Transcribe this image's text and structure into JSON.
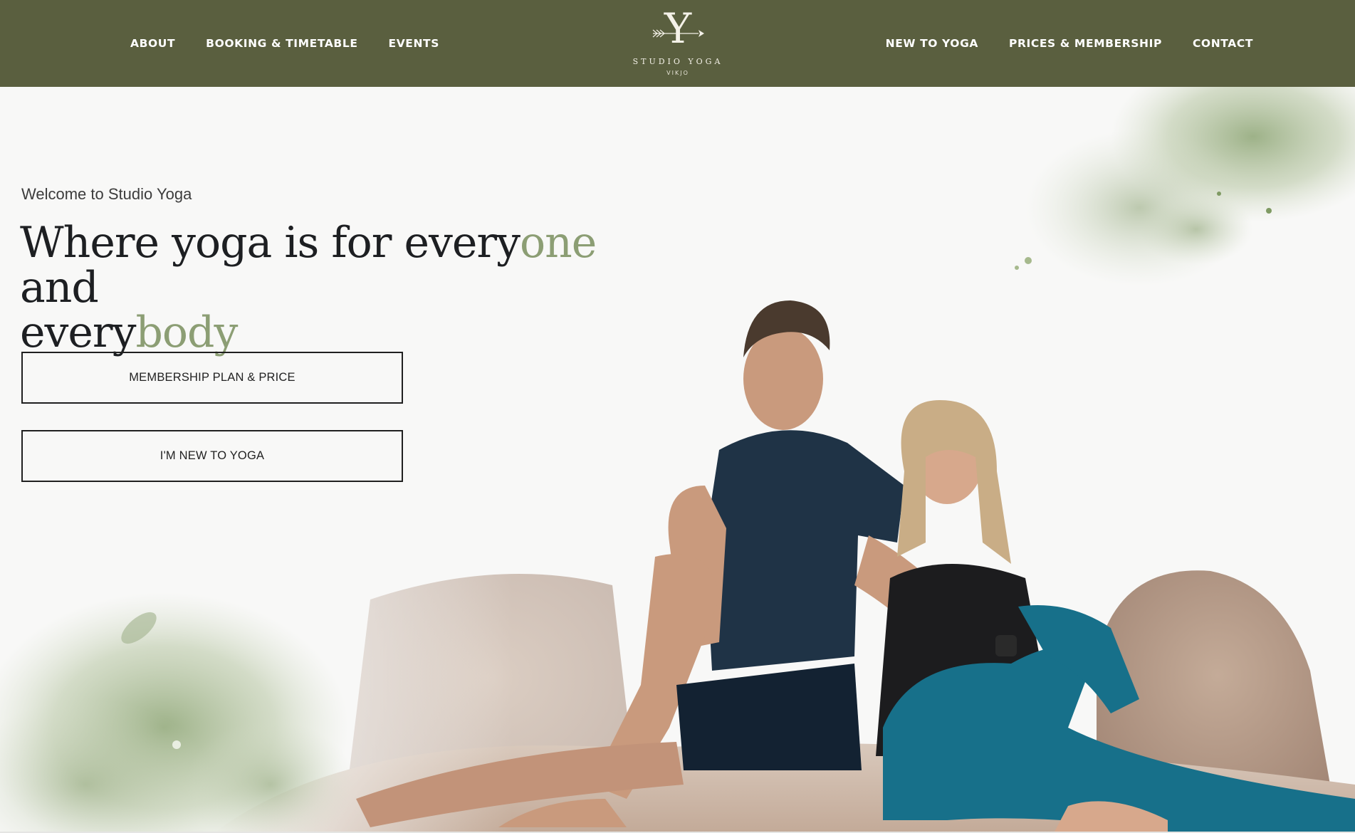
{
  "nav": {
    "left": [
      {
        "label": "ABOUT"
      },
      {
        "label": "BOOKING & TIMETABLE"
      },
      {
        "label": "EVENTS"
      }
    ],
    "right": [
      {
        "label": "NEW TO YOGA"
      },
      {
        "label": "PRICES & MEMBERSHIP"
      },
      {
        "label": "CONTACT"
      }
    ]
  },
  "logo": {
    "letter": "Y",
    "name": "STUDIO YOGA",
    "sub": "VIKJO"
  },
  "hero": {
    "welcome": "Welcome to Studio Yoga",
    "headline": {
      "part1": "Where yoga is for every",
      "accent1": "one",
      "part2": " and",
      "part3": "every",
      "accent2": "body"
    },
    "buttons": {
      "membership": "MEMBERSHIP PLAN & PRICE",
      "new_to_yoga": "I'M NEW TO YOGA"
    }
  },
  "colors": {
    "header_bg": "#5a5f3f",
    "accent": "#8c9e74",
    "page_bg": "#f8f8f7",
    "text": "#1d1f22"
  }
}
